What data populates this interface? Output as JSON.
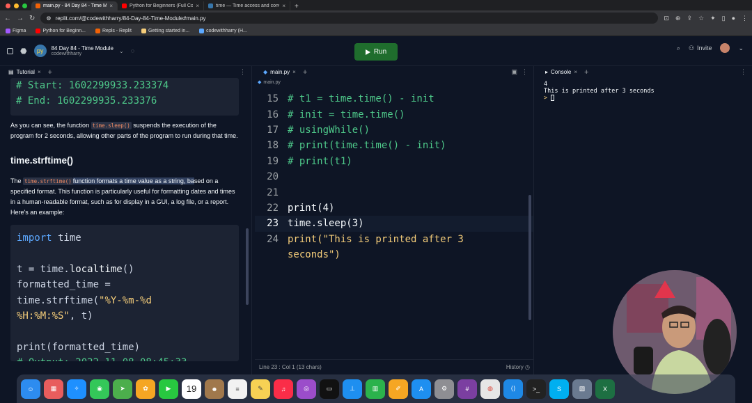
{
  "browser": {
    "tabs": [
      {
        "title": "main.py - 84 Day 84 - Time Mo",
        "color": "#f26207",
        "active": true
      },
      {
        "title": "Python for Beginners (Full Cou",
        "color": "#ff0000",
        "active": false
      },
      {
        "title": "time — Time access and conve",
        "color": "#3776ab",
        "active": false
      }
    ],
    "url": "replit.com/@codewithharry/84-Day-84-Time-Module#main.py",
    "bookmarks": [
      {
        "label": "Figma",
        "color": "#a259ff"
      },
      {
        "label": "Python for Beginn...",
        "color": "#ff0000"
      },
      {
        "label": "Repls - Replit",
        "color": "#f26207"
      },
      {
        "label": "Getting started in...",
        "color": "#f5cd7a"
      },
      {
        "label": "codewithharry (H...",
        "color": "#5ca8ff"
      }
    ]
  },
  "header": {
    "project_title": "84 Day 84 - Time Module",
    "owner": "codewithharry",
    "run_label": "Run",
    "invite_label": "Invite"
  },
  "tutorial": {
    "tab_label": "Tutorial",
    "top_code": [
      "# Start: 1602299933.233374",
      "# End: 1602299935.233376"
    ],
    "para1_pre": "As you can see, the function",
    "para1_code": "time.sleep()",
    "para1_post": "suspends the execution of the program for 2 seconds, allowing other parts of the program to run during that time.",
    "heading": "time.strftime()",
    "para2_pre": "The",
    "para2_code": "time.strftime()",
    "para2_hl": "function formats a time value as a string, ba",
    "para2_post": "sed on a specified format. This function is particularly useful for formatting dates and times in a human-readable format, such as for display in a GUI, a log file, or a report. Here's an example:",
    "example_lines": [
      "import time",
      "",
      "t = time.localtime()",
      "formatted_time =",
      "time.strftime(\"%Y-%m-%d",
      "%H:%M:%S\", t)",
      "",
      "print(formatted_time)",
      "# Output: 2022-11-08 08:45:33"
    ]
  },
  "editor": {
    "tab_label": "main.py",
    "breadcrumb": "main.py",
    "lines": [
      {
        "n": "15",
        "text": "# t1 = time.time() - init"
      },
      {
        "n": "16",
        "text": "# init = time.time()"
      },
      {
        "n": "17",
        "text": "# usingWhile()"
      },
      {
        "n": "18",
        "text": "# print(time.time() - init)"
      },
      {
        "n": "19",
        "text": "# print(t1)"
      },
      {
        "n": "20",
        "text": ""
      },
      {
        "n": "21",
        "text": ""
      },
      {
        "n": "22",
        "text": "print(4)"
      },
      {
        "n": "23",
        "text": "time.sleep(3)"
      },
      {
        "n": "24",
        "text": "print(\"This is printed after 3"
      },
      {
        "n": "",
        "text": "seconds\")"
      }
    ],
    "status_position": "Line 23 : Col 1 (13 chars)",
    "history_label": "History"
  },
  "console": {
    "tab_label": "Console",
    "output": [
      "4",
      "This is printed after 3 seconds"
    ],
    "prompt": ">"
  },
  "dock": {
    "calendar_day": "19",
    "apps": [
      {
        "name": "finder",
        "color": "#2d8cf0"
      },
      {
        "name": "launchpad",
        "color": "#e85d5d"
      },
      {
        "name": "safari",
        "color": "#1e90ff"
      },
      {
        "name": "messages",
        "color": "#34c759"
      },
      {
        "name": "maps",
        "color": "#4cae4c"
      },
      {
        "name": "photos",
        "color": "#f5a623"
      },
      {
        "name": "facetime",
        "color": "#28c840"
      },
      {
        "name": "calendar",
        "color": "#ffffff"
      },
      {
        "name": "contacts",
        "color": "#a0784c"
      },
      {
        "name": "reminders",
        "color": "#f2f2f2"
      },
      {
        "name": "notes",
        "color": "#f7d154"
      },
      {
        "name": "music",
        "color": "#fa2d48"
      },
      {
        "name": "podcasts",
        "color": "#9b4dca"
      },
      {
        "name": "tv",
        "color": "#111111"
      },
      {
        "name": "keynote",
        "color": "#1e8ff0"
      },
      {
        "name": "numbers",
        "color": "#2bb24c"
      },
      {
        "name": "pages",
        "color": "#f5a623"
      },
      {
        "name": "app-store",
        "color": "#1e8ff0"
      },
      {
        "name": "settings",
        "color": "#8e8e93"
      },
      {
        "name": "slack",
        "color": "#7b3fa1"
      },
      {
        "name": "chrome",
        "color": "#e6e6e6"
      },
      {
        "name": "vscode",
        "color": "#1e88e5"
      },
      {
        "name": "terminal",
        "color": "#222222"
      },
      {
        "name": "skype",
        "color": "#00aff0"
      },
      {
        "name": "preview",
        "color": "#6a7a90"
      },
      {
        "name": "excel",
        "color": "#1d6f42"
      }
    ]
  }
}
